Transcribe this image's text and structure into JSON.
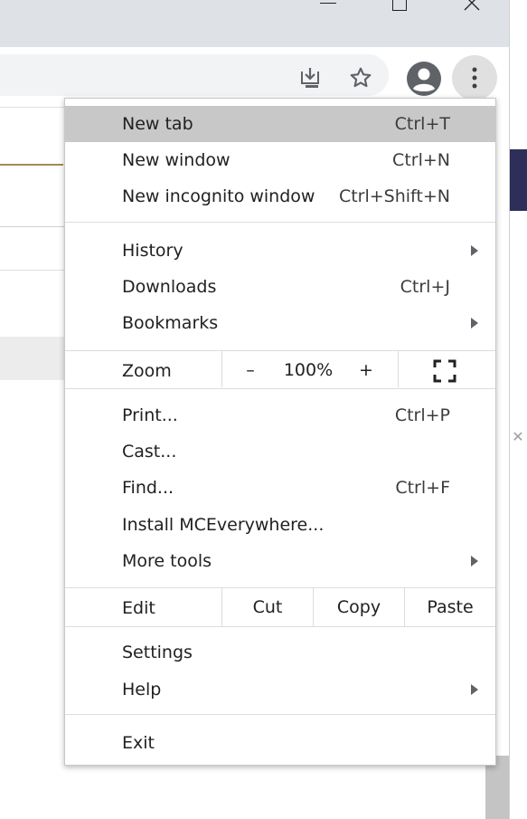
{
  "window": {
    "minimize_icon": "minimize-icon",
    "maximize_icon": "maximize-icon",
    "close_icon": "close-icon"
  },
  "toolbar": {
    "icons": [
      "install-app-icon",
      "bookmark-star-icon",
      "profile-avatar-icon",
      "more-vertical-icon"
    ]
  },
  "menu": {
    "items_top": [
      {
        "label": "New tab",
        "shortcut": "Ctrl+T",
        "highlighted": true
      },
      {
        "label": "New window",
        "shortcut": "Ctrl+N"
      },
      {
        "label": "New incognito window",
        "shortcut": "Ctrl+Shift+N"
      }
    ],
    "items_nav": [
      {
        "label": "History",
        "submenu": true
      },
      {
        "label": "Downloads",
        "shortcut": "Ctrl+J"
      },
      {
        "label": "Bookmarks",
        "submenu": true
      }
    ],
    "zoom": {
      "label": "Zoom",
      "minus": "–",
      "value": "100%",
      "plus": "+"
    },
    "items_tools": [
      {
        "label": "Print...",
        "shortcut": "Ctrl+P"
      },
      {
        "label": "Cast..."
      },
      {
        "label": "Find...",
        "shortcut": "Ctrl+F"
      },
      {
        "label": "Install MCEverywhere..."
      },
      {
        "label": "More tools",
        "submenu": true
      }
    ],
    "edit": {
      "label": "Edit",
      "cut": "Cut",
      "copy": "Copy",
      "paste": "Paste"
    },
    "items_settings": [
      {
        "label": "Settings"
      },
      {
        "label": "Help",
        "submenu": true
      }
    ],
    "exit": {
      "label": "Exit"
    }
  },
  "colors": {
    "highlight": "#c8c8c8",
    "titlebar": "#dee1e6",
    "accent_dark": "#2d2e59"
  }
}
